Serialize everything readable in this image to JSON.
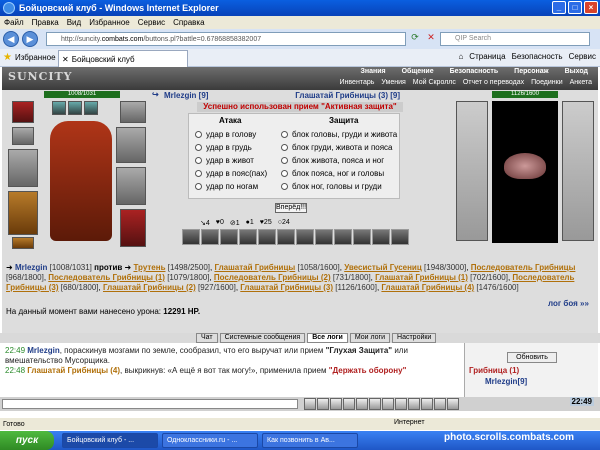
{
  "window": {
    "title": "Бойцовский клуб - Windows Internet Explorer"
  },
  "menu": [
    "Файл",
    "Правка",
    "Вид",
    "Избранное",
    "Сервис",
    "Справка"
  ],
  "address": {
    "prefix": "http://suncity.",
    "domain": "combats.com",
    "path": "/buttons.pl?battle=0.67868858382007",
    "search_placeholder": "QIP Search"
  },
  "favorites": {
    "label": "Избранное",
    "tab_title": "Бойцовский клуб"
  },
  "commands": [
    "Страница",
    "Безопасность",
    "Сервис"
  ],
  "game": {
    "logo": "SUNCITY",
    "nav_top": [
      "Знания",
      "Общение",
      "Безопасность",
      "Персонаж",
      "Выход"
    ],
    "nav_sub": [
      "Инвентарь",
      "Умения",
      "Мой Скроллс",
      "Отчет о переводах",
      "Поединки",
      "Анкета"
    ]
  },
  "left_char": {
    "hp_text": "1008/1031"
  },
  "right_char": {
    "hp_text": "1126/1600"
  },
  "battle": {
    "me_name": "Mrlezgin [9]",
    "enemy_name": "Глашатай Грибницы (3) [9]",
    "message": "Успешно использован прием \"Активная защита\"",
    "attack_header": "Атака",
    "defense_header": "Защита",
    "attacks": [
      "удар в голову",
      "удар в грудь",
      "удар в живот",
      "удар в пояс(пах)",
      "удар по ногам"
    ],
    "defenses": [
      "блок головы, груди и живота",
      "блок груди, живота и пояса",
      "блок живота, пояса и ног",
      "блок пояса, ног и головы",
      "блок ног, головы и груди"
    ],
    "forward_button": "Вперёд!!!",
    "counters": [
      "4",
      "0",
      "1",
      "1",
      "25",
      "24"
    ]
  },
  "opponents": {
    "me": "Mrlezgin",
    "me_hp": "[1008/1031]",
    "vs": "против",
    "list": [
      {
        "name": "Трутень",
        "hp": "[1498/2500]"
      },
      {
        "name": "Глашатай Грибницы",
        "hp": "[1058/1600]"
      },
      {
        "name": "Увесистый Гусениц",
        "hp": "[1948/3000]"
      },
      {
        "name": "Последователь Грибницы",
        "hp": "[968/1800]"
      },
      {
        "name": "Последователь Грибницы (1)",
        "hp": "[1079/1800]"
      },
      {
        "name": "Последователь Грибницы (2)",
        "hp": "[731/1800]"
      },
      {
        "name": "Глашатай Грибницы (1)",
        "hp": "[702/1600]"
      },
      {
        "name": "Последователь Грибницы (3)",
        "hp": "[680/1800]"
      },
      {
        "name": "Глашатай Грибницы (2)",
        "hp": "[927/1600]"
      },
      {
        "name": "Глашатай Грибницы (3)",
        "hp": "[1126/1600]"
      },
      {
        "name": "Глашатай Грибницы (4)",
        "hp": "[1476/1600]"
      }
    ]
  },
  "damage": {
    "text": "На данный момент вами нанесено урона:",
    "value": "12291 HP."
  },
  "fight_log": "лог боя »»",
  "log_tabs": [
    "Чат",
    "Системные сообщения",
    "Все логи",
    "Мои логи",
    "Настройки"
  ],
  "chat": [
    {
      "time": "22:49",
      "who": "Mrlezgin",
      "text": ", пораскинув мозгами по земле, сообразил, что его выручат или прием",
      "tech": "\"Глухая Защита\"",
      "tail": "или вмешательство Мусорщика."
    },
    {
      "time": "22:48",
      "who": "Глашатай Грибницы (4)",
      "text": ", выкрикнув: «А ещё я вот так могу!», применила прием",
      "tech": "\"Держать оборону\"",
      "tail": ""
    }
  ],
  "roster": {
    "refresh": "Обновить",
    "group": "Грибница (1)",
    "member": "Mrlezgin[9]"
  },
  "clock": "22:49",
  "status": {
    "left": "Готово",
    "zone": "Интернет"
  },
  "taskbar": {
    "start": "пуск",
    "items": [
      "Бойцовский клуб - ...",
      "Одноклассники.ru - ...",
      "Как позвонить в Ав..."
    ]
  },
  "watermark": "photo.scrolls.combats.com"
}
